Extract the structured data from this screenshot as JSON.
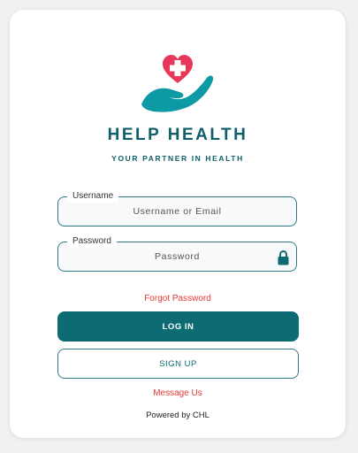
{
  "brand": {
    "logo_icon": "hand-heart-icon",
    "title": "HELP HEALTH",
    "tagline": "YOUR PARTNER IN HEALTH"
  },
  "login_form": {
    "username": {
      "label": "Username",
      "placeholder": "Username or Email",
      "value": ""
    },
    "password": {
      "label": "Password",
      "placeholder": "Password",
      "value": "",
      "icon": "lock-icon"
    },
    "forgot_password_link": "Forgot Password",
    "login_button": "LOG IN",
    "signup_button": "SIGN UP",
    "message_link": "Message Us"
  },
  "footer": {
    "powered_by": "Powered by CHL"
  },
  "colors": {
    "primary": "#0d6b73",
    "heart": "#e8385a",
    "link": "#e53935"
  }
}
